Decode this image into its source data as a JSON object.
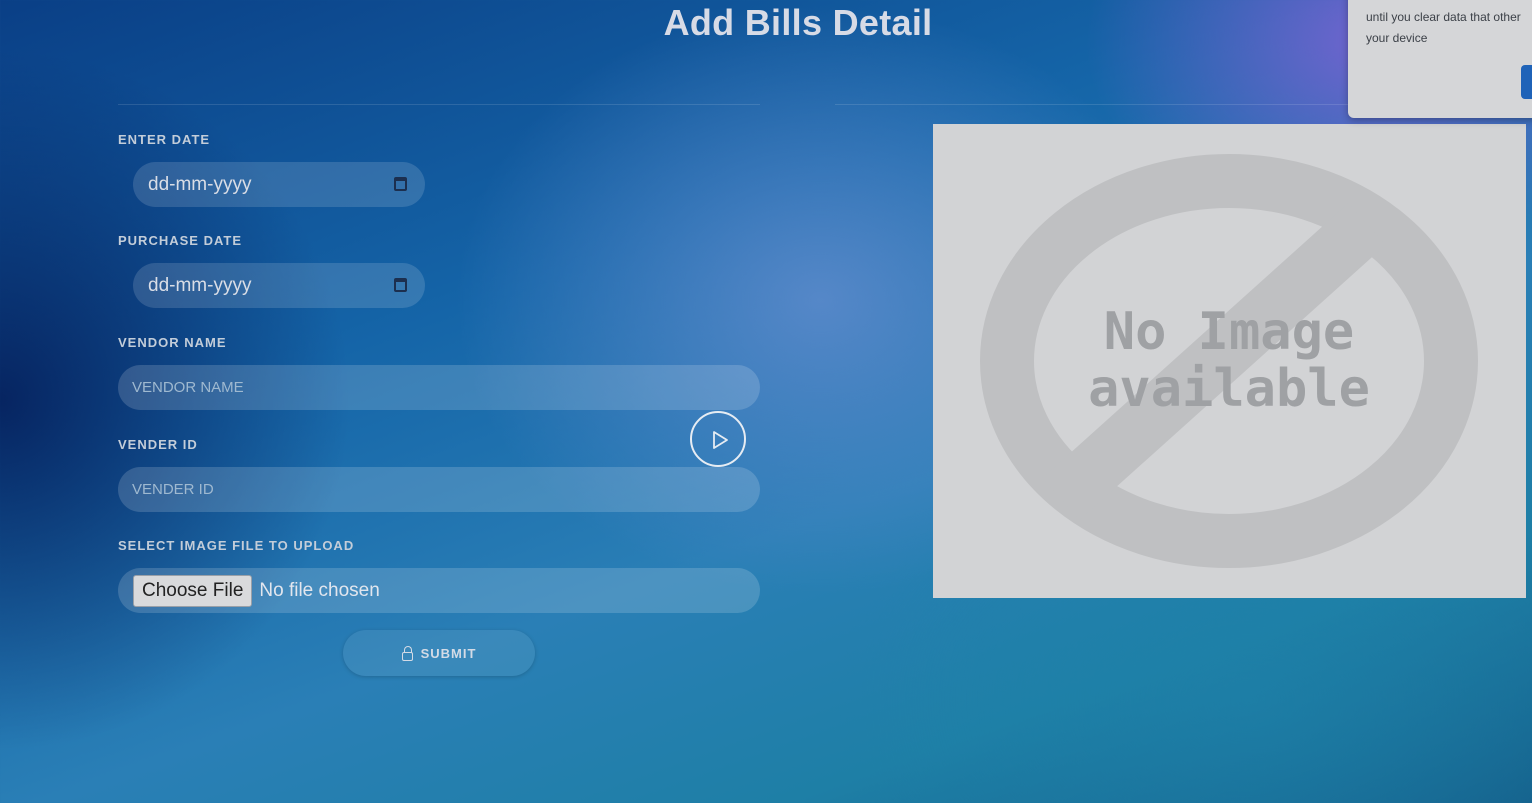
{
  "page": {
    "title": "Add Bills Detail"
  },
  "form": {
    "enter_date_label": "ENTER DATE",
    "enter_date_value": "dd-mm-yyyy",
    "purchase_date_label": "PURCHASE DATE",
    "purchase_date_value": "dd-mm-yyyy",
    "vendor_name_label": "VENDOR NAME",
    "vendor_name_placeholder": "VENDOR NAME",
    "vender_id_label": "VENDER ID",
    "vender_id_placeholder": "VENDER ID",
    "file_label": "SELECT IMAGE FILE TO UPLOAD",
    "file_button": "Choose File",
    "file_status": "No file chosen",
    "submit_label": "SUBMIT"
  },
  "preview": {
    "line1": "No Image",
    "line2": "available"
  },
  "popup": {
    "text": "until you clear data that other",
    "text2": "your device"
  },
  "colors": {
    "accent_button": "#1f63b8",
    "preview_bg": "#d2d3d5"
  }
}
